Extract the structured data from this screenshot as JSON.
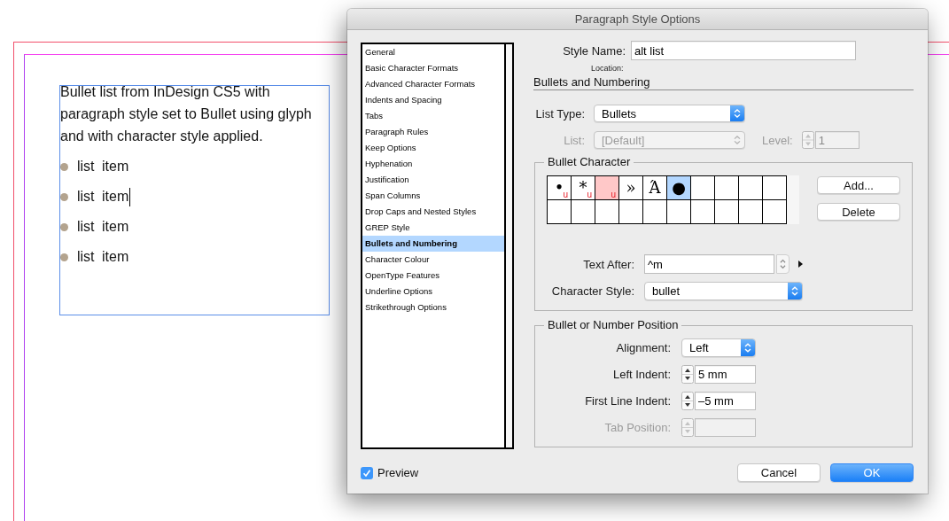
{
  "canvas": {
    "paragraph": "Bullet list from InDesign CS5 with paragraph style set to Bullet using glyph and with character style applied.",
    "list_items": [
      {
        "text": "list item",
        "cursor": false
      },
      {
        "text": "list item",
        "cursor": true
      },
      {
        "text": "list item",
        "cursor": false
      },
      {
        "text": "list item",
        "cursor": false
      }
    ]
  },
  "dialog": {
    "title": "Paragraph Style Options",
    "categories": [
      {
        "label": "General",
        "selected": false
      },
      {
        "label": "Basic Character Formats",
        "selected": false
      },
      {
        "label": "Advanced Character Formats",
        "selected": false
      },
      {
        "label": "Indents and Spacing",
        "selected": false
      },
      {
        "label": "Tabs",
        "selected": false
      },
      {
        "label": "Paragraph Rules",
        "selected": false
      },
      {
        "label": "Keep Options",
        "selected": false
      },
      {
        "label": "Hyphenation",
        "selected": false
      },
      {
        "label": "Justification",
        "selected": false
      },
      {
        "label": "Span Columns",
        "selected": false
      },
      {
        "label": "Drop Caps and Nested Styles",
        "selected": false
      },
      {
        "label": "GREP Style",
        "selected": false
      },
      {
        "label": "Bullets and Numbering",
        "selected": true
      },
      {
        "label": "Character Colour",
        "selected": false
      },
      {
        "label": "OpenType Features",
        "selected": false
      },
      {
        "label": "Underline Options",
        "selected": false
      },
      {
        "label": "Strikethrough Options",
        "selected": false
      }
    ],
    "style_name": {
      "label": "Style Name:",
      "value": "alt list"
    },
    "location_label": "Location:",
    "section_title": "Bullets and Numbering",
    "list_type": {
      "label": "List Type:",
      "value": "Bullets",
      "disabled": false
    },
    "list": {
      "label": "List:",
      "value": "[Default]",
      "disabled": true
    },
    "level": {
      "label": "Level:",
      "value": "1",
      "disabled": true
    },
    "bullet_character": {
      "title": "Bullet Character",
      "cells": [
        {
          "glyph": "•",
          "flag": "u",
          "selected": false,
          "missing": false
        },
        {
          "glyph": "*",
          "flag": "u",
          "selected": false,
          "missing": false
        },
        {
          "flag": "u",
          "selected": false,
          "missing": true
        },
        {
          "glyph": "»",
          "selected": false,
          "missing": false
        },
        {
          "glyph": "Ά",
          "selected": false,
          "missing": false
        },
        {
          "glyph": "●",
          "selected": true,
          "missing": false
        },
        {
          "selected": false,
          "missing": false
        },
        {
          "selected": false,
          "missing": false
        },
        {
          "selected": false,
          "missing": false
        },
        {
          "selected": false,
          "missing": false
        },
        {
          "selected": false,
          "missing": false
        },
        {
          "selected": false,
          "missing": false
        },
        {
          "selected": false,
          "missing": false
        },
        {
          "selected": false,
          "missing": false
        },
        {
          "selected": false,
          "missing": false
        },
        {
          "selected": false,
          "missing": false
        },
        {
          "selected": false,
          "missing": false
        },
        {
          "selected": false,
          "missing": false
        },
        {
          "selected": false,
          "missing": false
        },
        {
          "selected": false,
          "missing": false
        }
      ],
      "buttons": [
        "Add...",
        "Delete"
      ],
      "text_after": {
        "label": "Text After:",
        "value": "^m"
      },
      "character_style": {
        "label": "Character Style:",
        "value": "bullet"
      }
    },
    "position": {
      "title": "Bullet or Number Position",
      "fields": [
        {
          "kind": "popup",
          "label": "Alignment:",
          "value": "Left",
          "disabled": false
        },
        {
          "kind": "stepper",
          "label": "Left Indent:",
          "value": "5 mm",
          "disabled": false
        },
        {
          "kind": "stepper",
          "label": "First Line Indent:",
          "value": "–5 mm",
          "disabled": false
        },
        {
          "kind": "stepper",
          "label": "Tab Position:",
          "disabled": true
        }
      ]
    },
    "preview": {
      "label": "Preview",
      "checked": true
    },
    "buttons": [
      {
        "label": "Cancel",
        "default": false
      },
      {
        "label": "OK",
        "default": true
      }
    ]
  }
}
